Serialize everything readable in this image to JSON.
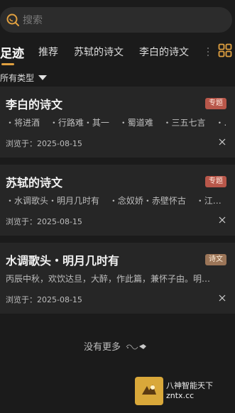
{
  "search": {
    "placeholder": "搜索"
  },
  "tabs": [
    "足迹",
    "推荐",
    "苏轼的诗文",
    "李白的诗文"
  ],
  "filter": {
    "label": "所有类型"
  },
  "cards": [
    {
      "title": "李白的诗文",
      "badge": "专题",
      "items": [
        "・将进酒",
        "・行路难・其一",
        "・蜀道难",
        "・三五七言",
        "・…"
      ],
      "date": "浏览于：2025-08-15"
    },
    {
      "title": "苏轼的诗文",
      "badge": "专题",
      "items": [
        "・水调歌头・明月几时有",
        "・念奴娇・赤壁怀古",
        "・江…"
      ],
      "date": "浏览于：2025-08-15"
    },
    {
      "title": "水调歌头・明月几时有",
      "badge": "诗文",
      "excerpt": "丙辰中秋，欢饮达旦，大醉，作此篇，兼怀子由。明…",
      "date": "浏览于：2025-08-15"
    }
  ],
  "footer": {
    "no_more": "没有更多"
  },
  "watermark": {
    "line1": "八神智能天下",
    "line2": "zntx.cc"
  },
  "colors": {
    "accent": "#e0a040",
    "topic_badge": "#b8574a",
    "poem_badge": "#9b7558",
    "background": "#1b1b1b",
    "card": "#262626"
  }
}
